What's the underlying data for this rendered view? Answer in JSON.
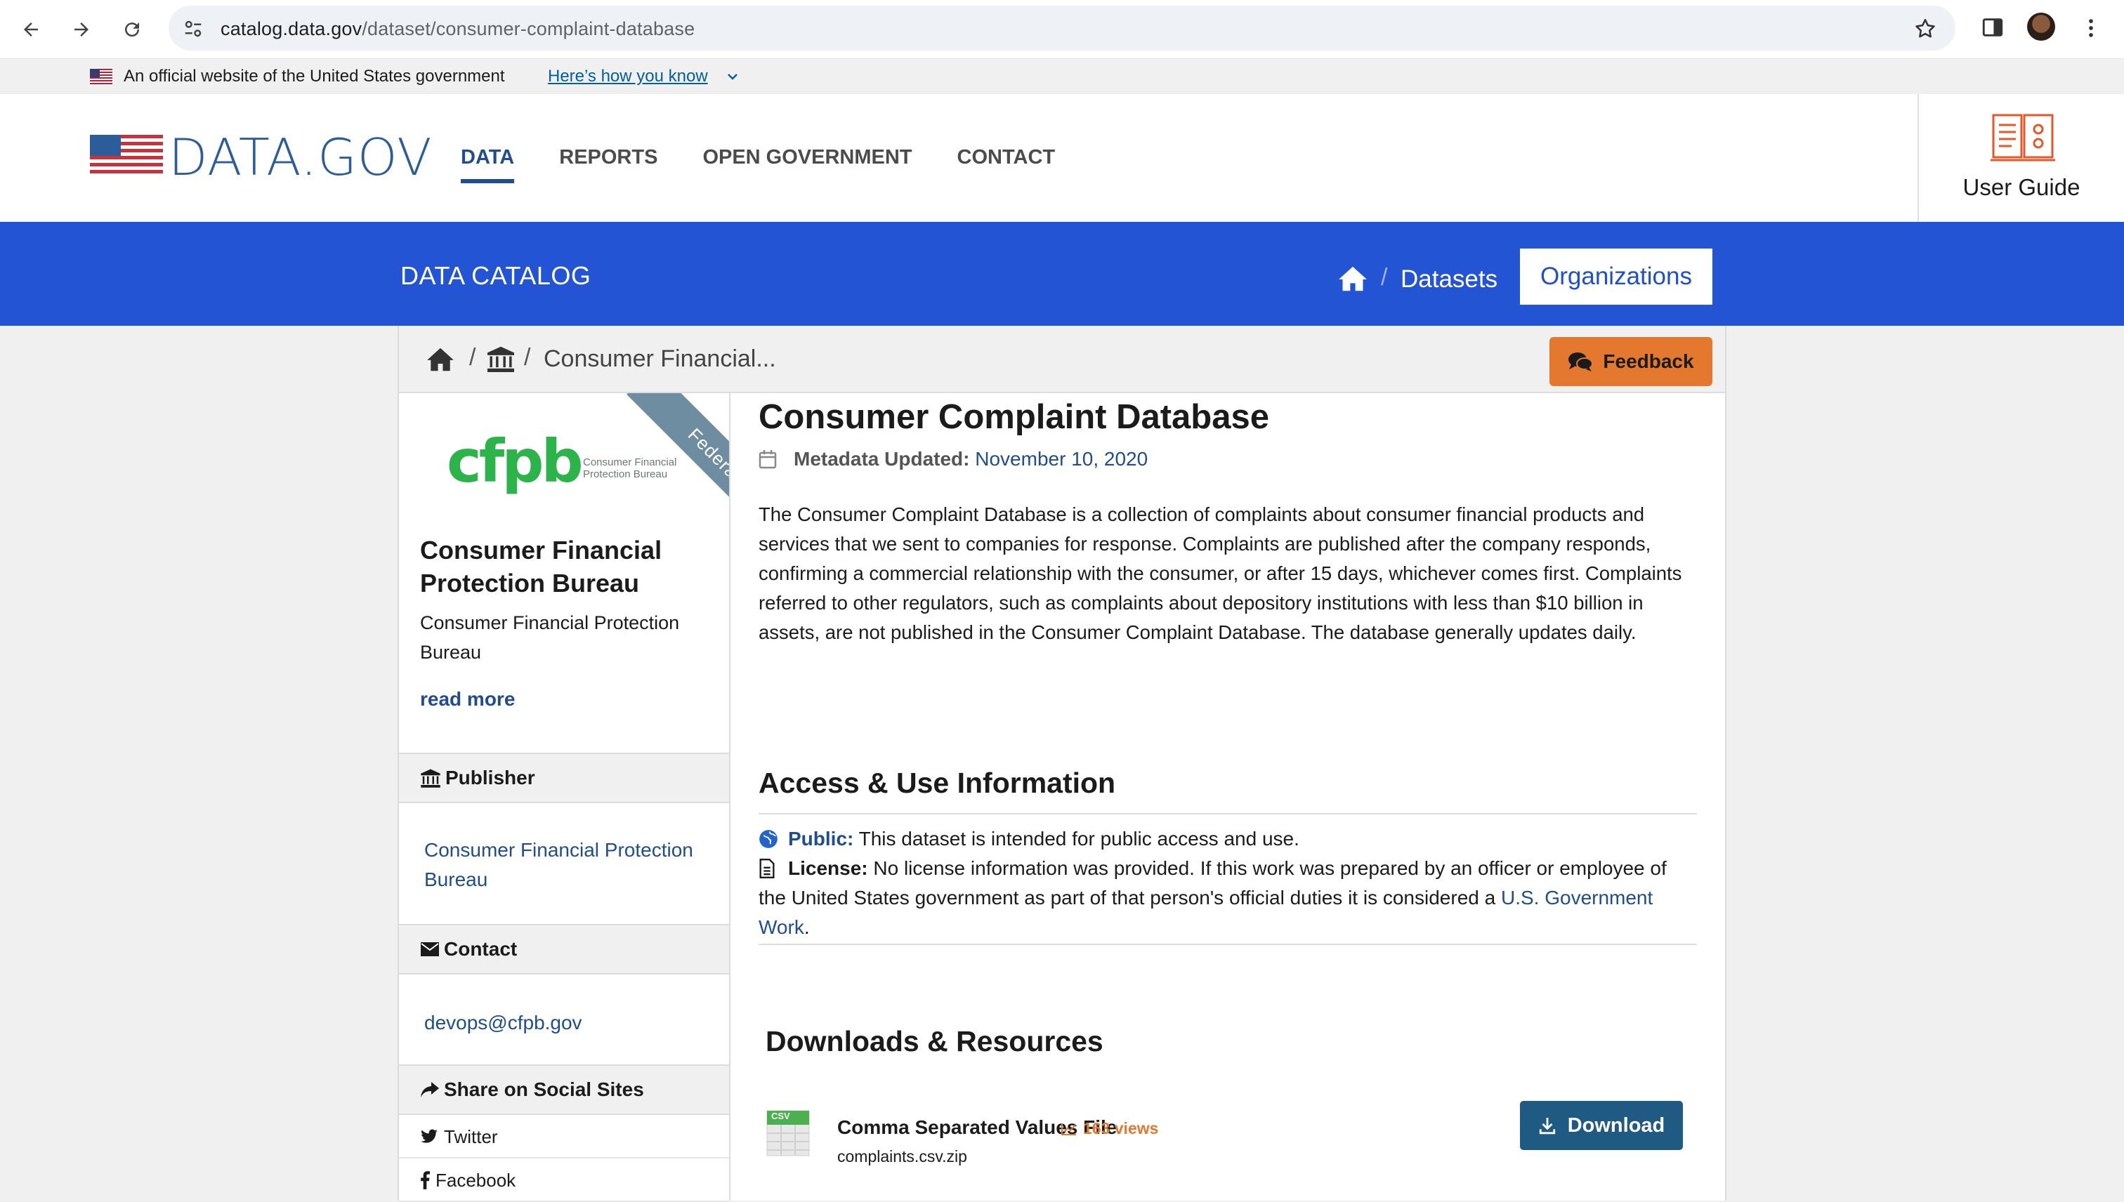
{
  "browser": {
    "url_host": "catalog.data.gov",
    "url_path": "/dataset/consumer-complaint-database"
  },
  "gov_banner": {
    "text": "An official website of the United States government",
    "link": "Here’s how you know"
  },
  "header": {
    "logo_text": "DATA.GOV",
    "nav": [
      "DATA",
      "REPORTS",
      "OPEN GOVERNMENT",
      "CONTACT"
    ],
    "active_nav": "DATA",
    "user_guide": "User Guide"
  },
  "catalog_bar": {
    "title": "DATA CATALOG",
    "datasets": "Datasets",
    "organizations": "Organizations",
    "separator": "/"
  },
  "breadcrumb": {
    "separator": "/",
    "current": "Consumer Financial...",
    "feedback": "Feedback"
  },
  "sidebar": {
    "ribbon": "Federal",
    "logo_mark": "cfpb",
    "logo_sub": "Consumer Financial Protection Bureau",
    "org_name": "Consumer Financial Protection Bureau",
    "org_desc": "Consumer Financial Protection Bureau",
    "read_more": "read more",
    "publisher_head": "Publisher",
    "publisher": "Consumer Financial Protection Bureau",
    "contact_head": "Contact",
    "contact_email": "devops@cfpb.gov",
    "share_head": "Share on Social Sites",
    "social": [
      "Twitter",
      "Facebook"
    ]
  },
  "dataset": {
    "title": "Consumer Complaint Database",
    "meta_label": "Metadata Updated:",
    "meta_value": "November 10, 2020",
    "description": "The Consumer Complaint Database is a collection of complaints about consumer financial products and services that we sent to companies for response. Complaints are published after the company responds, confirming a commercial relationship with the consumer, or after 15 days, whichever comes first. Complaints referred to other regulators, such as complaints about depository institutions with less than $10 billion in assets, are not published in the Consumer Complaint Database. The database generally updates daily.",
    "access_heading": "Access & Use Information",
    "public_label": "Public:",
    "public_text": "This dataset is intended for public access and use.",
    "license_label": "License:",
    "license_text": "No license information was provided. If this work was prepared by an officer or employee of the United States government as part of that person's official duties it is considered a",
    "license_link": "U.S. Government Work",
    "license_end": ".",
    "downloads_heading": "Downloads & Resources",
    "resource": {
      "badge": "CSV",
      "name": "Comma Separated Values File",
      "views": "163 views",
      "file": "complaints.csv.zip",
      "download": "Download"
    }
  },
  "colors": {
    "catalog_bar": "#2254d4",
    "link": "#1f4d8f",
    "accent_orange": "#e5782f",
    "download_btn": "#1f5a82",
    "cfpb_green": "#2cb34a"
  }
}
